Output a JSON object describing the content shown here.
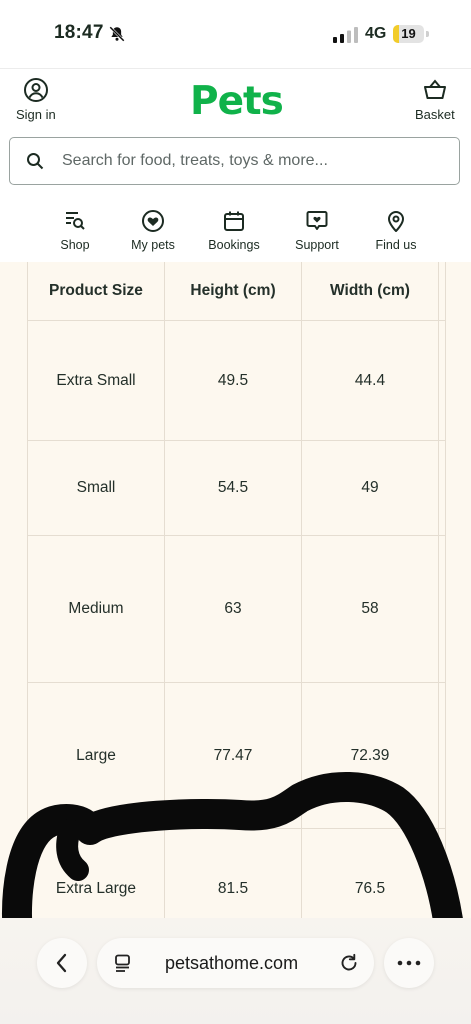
{
  "status_bar": {
    "time": "18:47",
    "network": "4G",
    "battery": "19",
    "battery_fraction": 0.19
  },
  "header": {
    "logo": "Pets",
    "sign_in_label": "Sign in",
    "basket_label": "Basket",
    "search_placeholder": "Search for food, treats, toys & more...",
    "brand_color": "#10b24a"
  },
  "nav": {
    "items": [
      {
        "label": "Shop",
        "icon": "shop-search-icon"
      },
      {
        "label": "My pets",
        "icon": "heart-badge-icon"
      },
      {
        "label": "Bookings",
        "icon": "calendar-icon"
      },
      {
        "label": "Support",
        "icon": "chat-heart-icon"
      },
      {
        "label": "Find us",
        "icon": "location-pin-icon"
      }
    ]
  },
  "size_table": {
    "headers": [
      "Product Size",
      "Height (cm)",
      "Width (cm)"
    ],
    "rows": [
      [
        "Extra Small",
        "49.5",
        "44.4"
      ],
      [
        "Small",
        "54.5",
        "49"
      ],
      [
        "Medium",
        "63",
        "58"
      ],
      [
        "Large",
        "77.47",
        "72.39"
      ],
      [
        "Extra Large",
        "81.5",
        "76.5"
      ]
    ]
  },
  "browser_bar": {
    "url": "petsathome.com"
  }
}
